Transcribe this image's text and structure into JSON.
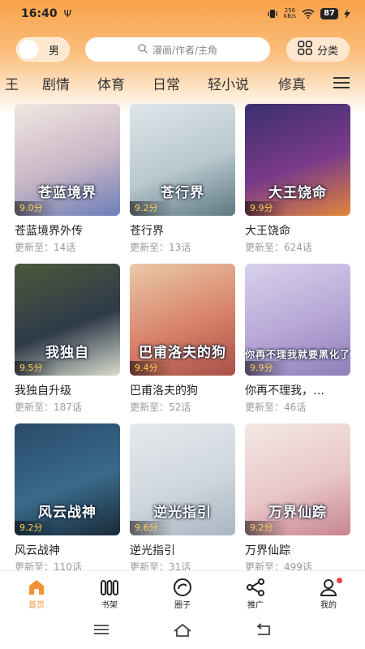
{
  "status_bar": {
    "time": "16:40",
    "usb": "Ψ",
    "net_speed_value": "256",
    "net_speed_unit": "KB/s",
    "battery": "87"
  },
  "header": {
    "gender_label": "男",
    "search_placeholder": "漫画/作者/主角",
    "category_label": "分类"
  },
  "tabs": [
    {
      "label": "王"
    },
    {
      "label": "剧情"
    },
    {
      "label": "体育"
    },
    {
      "label": "日常"
    },
    {
      "label": "轻小说"
    },
    {
      "label": "修真"
    }
  ],
  "comics": [
    {
      "title": "苍蓝境界外传",
      "cover_text": "苍蓝境界",
      "rating": "9.0分",
      "update": "更新至：14话",
      "colors": [
        "#f1e7e1",
        "#c9b6c6",
        "#6a7fb8"
      ]
    },
    {
      "title": "苍行界",
      "cover_text": "苍行界",
      "rating": "9.2分",
      "update": "更新至：13话",
      "colors": [
        "#dfe6ea",
        "#b9c9cf",
        "#5e7883"
      ]
    },
    {
      "title": "大王饶命",
      "cover_text": "大王饶命",
      "rating": "9.9分",
      "update": "更新至：624话",
      "colors": [
        "#3a2f6e",
        "#7a3a8a",
        "#e0863a"
      ]
    },
    {
      "title": "我独自升级",
      "cover_text": "我独自",
      "rating": "9.5分",
      "update": "更新至：187话",
      "colors": [
        "#4a5a3a",
        "#2f3a4a",
        "#d9dccd"
      ]
    },
    {
      "title": "巴甫洛夫的狗",
      "cover_text": "巴甫洛夫的狗",
      "rating": "9.4分",
      "update": "更新至：52话",
      "colors": [
        "#e9c9a8",
        "#d8826a",
        "#a85048"
      ]
    },
    {
      "title": "你再不理我，…",
      "cover_text": "你再不理我就要黑化了",
      "rating": "9.9分",
      "update": "更新至：46话",
      "colors": [
        "#d8d2ec",
        "#b6a6d6",
        "#8e7fb8"
      ]
    },
    {
      "title": "风云战神",
      "cover_text": "风云战神",
      "rating": "9.2分",
      "update": "更新至：110话",
      "colors": [
        "#2a4a6a",
        "#3a6a8a",
        "#1a2a3a"
      ]
    },
    {
      "title": "逆光指引",
      "cover_text": "逆光指引",
      "rating": "9.6分",
      "update": "更新至：31话",
      "colors": [
        "#e6e9ec",
        "#cfd7de",
        "#aab6c2"
      ]
    },
    {
      "title": "万界仙踪",
      "cover_text": "万界仙踪",
      "rating": "9.2分",
      "update": "更新至：499话",
      "colors": [
        "#f3e9e4",
        "#e9c7c9",
        "#c8858f"
      ]
    }
  ],
  "bottom_nav": [
    {
      "label": "首页",
      "icon": "home-icon"
    },
    {
      "label": "书架",
      "icon": "bookshelf-icon"
    },
    {
      "label": "圈子",
      "icon": "circle-icon"
    },
    {
      "label": "推广",
      "icon": "share-icon"
    },
    {
      "label": "我的",
      "icon": "user-icon"
    }
  ],
  "accent_color": "#f29236"
}
